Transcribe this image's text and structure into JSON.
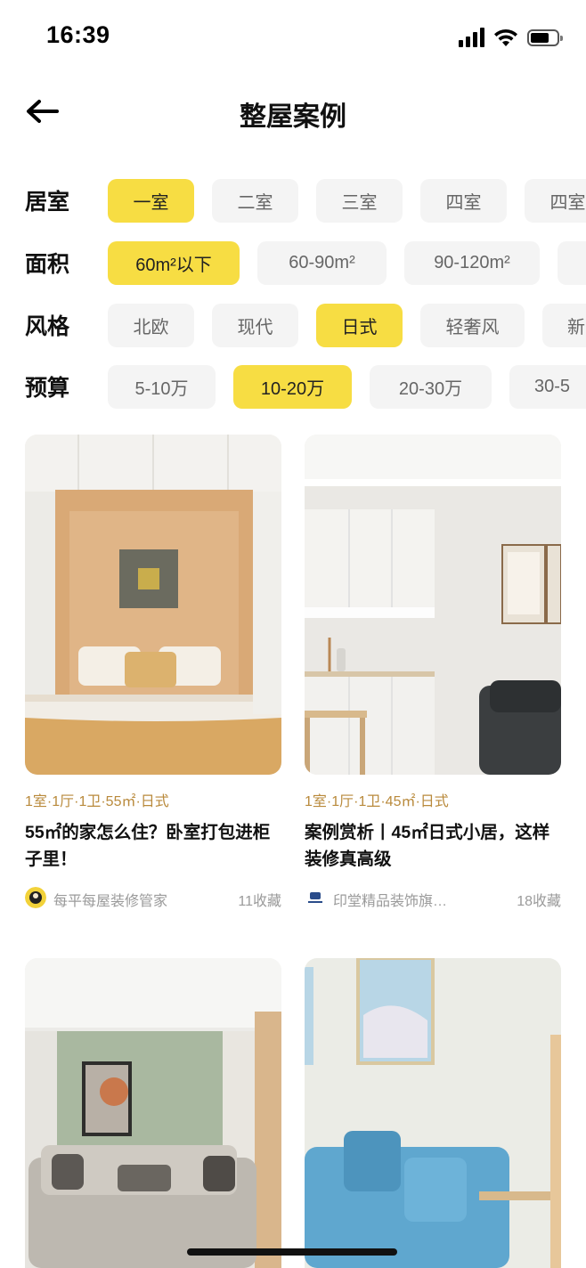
{
  "status_bar": {
    "time": "16:39"
  },
  "header": {
    "title": "整屋案例"
  },
  "filters": {
    "room": {
      "label": "居室",
      "options": [
        "一室",
        "二室",
        "三室",
        "四室",
        "四室"
      ]
    },
    "area": {
      "label": "面积",
      "options": [
        "60m²以下",
        "60-90m²",
        "90-120m²"
      ]
    },
    "style": {
      "label": "风格",
      "options": [
        "北欧",
        "现代",
        "日式",
        "轻奢风",
        "新"
      ]
    },
    "budget": {
      "label": "预算",
      "options": [
        "5-10万",
        "10-20万",
        "20-30万",
        "30-5"
      ]
    }
  },
  "cards": [
    {
      "meta": "1室·1厅·1卫·55㎡·日式",
      "title": "55㎡的家怎么住？卧室打包进柜子里！",
      "author": "每平每屋装修管家",
      "favorites": "11收藏"
    },
    {
      "meta": "1室·1厅·1卫·45㎡·日式",
      "title": "案例赏析丨45㎡日式小居，这样装修真高级",
      "author": "印堂精品装饰旗…",
      "favorites": "18收藏"
    }
  ],
  "colors": {
    "accent": "#f7dd43",
    "meta_text": "#b98a3c",
    "chip_bg": "#f4f4f4"
  }
}
